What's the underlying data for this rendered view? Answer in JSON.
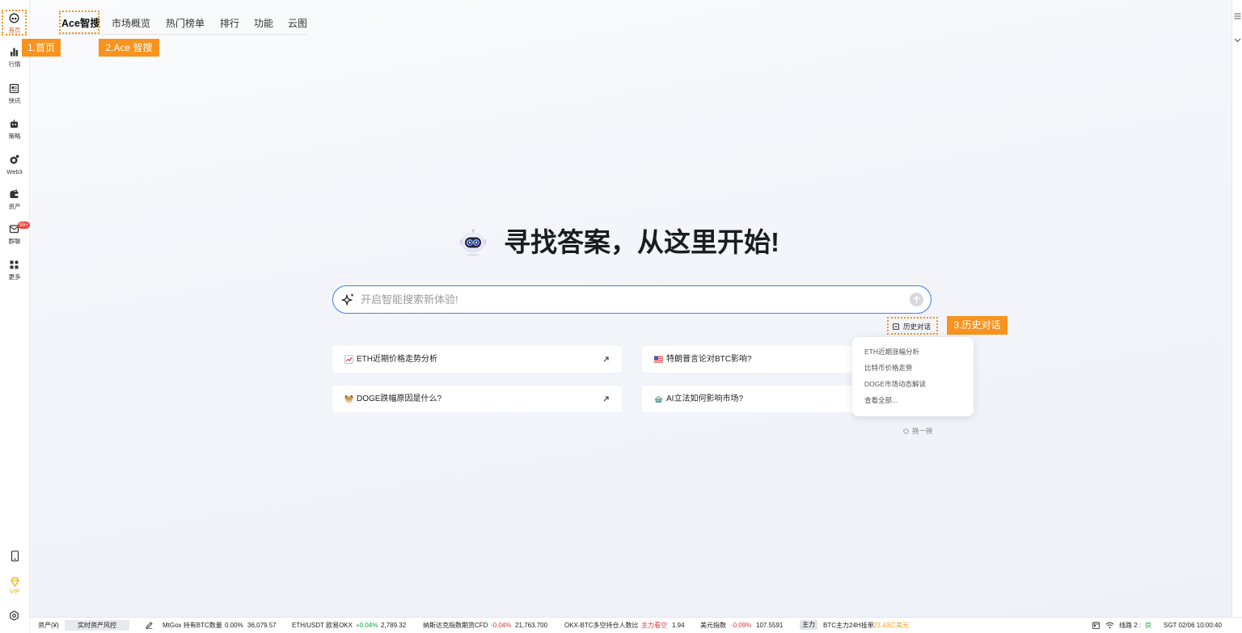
{
  "colors": {
    "annotation_orange": "#f7931e",
    "search_border": "#3d7ef5",
    "up_green": "#16a34a",
    "down_red": "#e0383e",
    "highlight_orange": "#f5a21a",
    "vip_gold": "#e2b007",
    "active_label": "#f2552c",
    "badge_red": "#f0443a"
  },
  "sidebar": {
    "items": [
      {
        "label": "首页",
        "icon": "home-logo-icon",
        "active": true
      },
      {
        "label": "行情",
        "icon": "bar-chart-icon"
      },
      {
        "label": "快讯",
        "icon": "news-icon"
      },
      {
        "label": "策略",
        "icon": "robot-icon"
      },
      {
        "label": "Web3",
        "icon": "web3-icon"
      },
      {
        "label": "资产",
        "icon": "wallet-icon"
      },
      {
        "label": "群聊",
        "icon": "chat-icon",
        "badge": "99+"
      },
      {
        "label": "更多",
        "icon": "grid-icon"
      }
    ],
    "bottom": {
      "phone_icon": "phone-icon",
      "vip_icon": "vip-diamond-icon",
      "vip_label": "VIP",
      "settings_icon": "settings-gear-icon"
    }
  },
  "tabs": [
    {
      "label": "Ace智搜",
      "active": true
    },
    {
      "label": "市场概览"
    },
    {
      "label": "热门榜单"
    },
    {
      "label": "排行"
    },
    {
      "label": "功能"
    },
    {
      "label": "云图"
    }
  ],
  "annotations": {
    "home": "1.首页",
    "ace_search": "2.Ace 智搜",
    "history": "3.历史对话"
  },
  "hero": {
    "icon": "ai-robot-icon",
    "title": "寻找答案，从这里开始!"
  },
  "search": {
    "icon": "sparkle-icon",
    "placeholder": "开启智能搜索新体验!",
    "submit_icon": "arrow-up-icon"
  },
  "history": {
    "icon": "history-icon",
    "button_label": "历史对话",
    "items": [
      "ETH近期涨幅分析",
      "比特币价格走势",
      "DOGE市场动态解读",
      "查看全部..."
    ]
  },
  "suggestions": [
    {
      "icon": "chart-increasing-icon",
      "text": "ETH近期价格走势分析"
    },
    {
      "icon": "us-flag-icon",
      "text": "特朗普言论对BTC影响?"
    },
    {
      "icon": "dog-face-icon",
      "text": "DOGE跌幅原因是什么?"
    },
    {
      "icon": "basket-icon",
      "text": "AI立法如何影响市场?"
    }
  ],
  "refresh_label": "换一换",
  "status_bar": {
    "assets_label": "资产(¥)",
    "risk_button": "实时资产风控",
    "tickers": [
      {
        "name": "MtGox 持有BTC数量",
        "change": "0.00%",
        "value": "36,079.57"
      },
      {
        "name": "ETH/USDT 欧易OKX",
        "change": "+0.04%",
        "value": "2,789.32"
      },
      {
        "name": "纳斯达克指数期货CFD",
        "change": "-0.04%",
        "value": "21,763.700"
      },
      {
        "name": "OKX-BTC多空持仓人数比",
        "change": "主力看空",
        "value": "1.94"
      },
      {
        "name": "美元指数",
        "change": "-0.09%",
        "value": "107.5591"
      }
    ],
    "main_force_badge": "主力",
    "main_force_label": "BTC主力24H挂单",
    "main_force_value": "23.43亿美元",
    "line_label": "线路 2 :",
    "line_quality": "良",
    "clock": "SGT 02/06 10:00:40"
  }
}
